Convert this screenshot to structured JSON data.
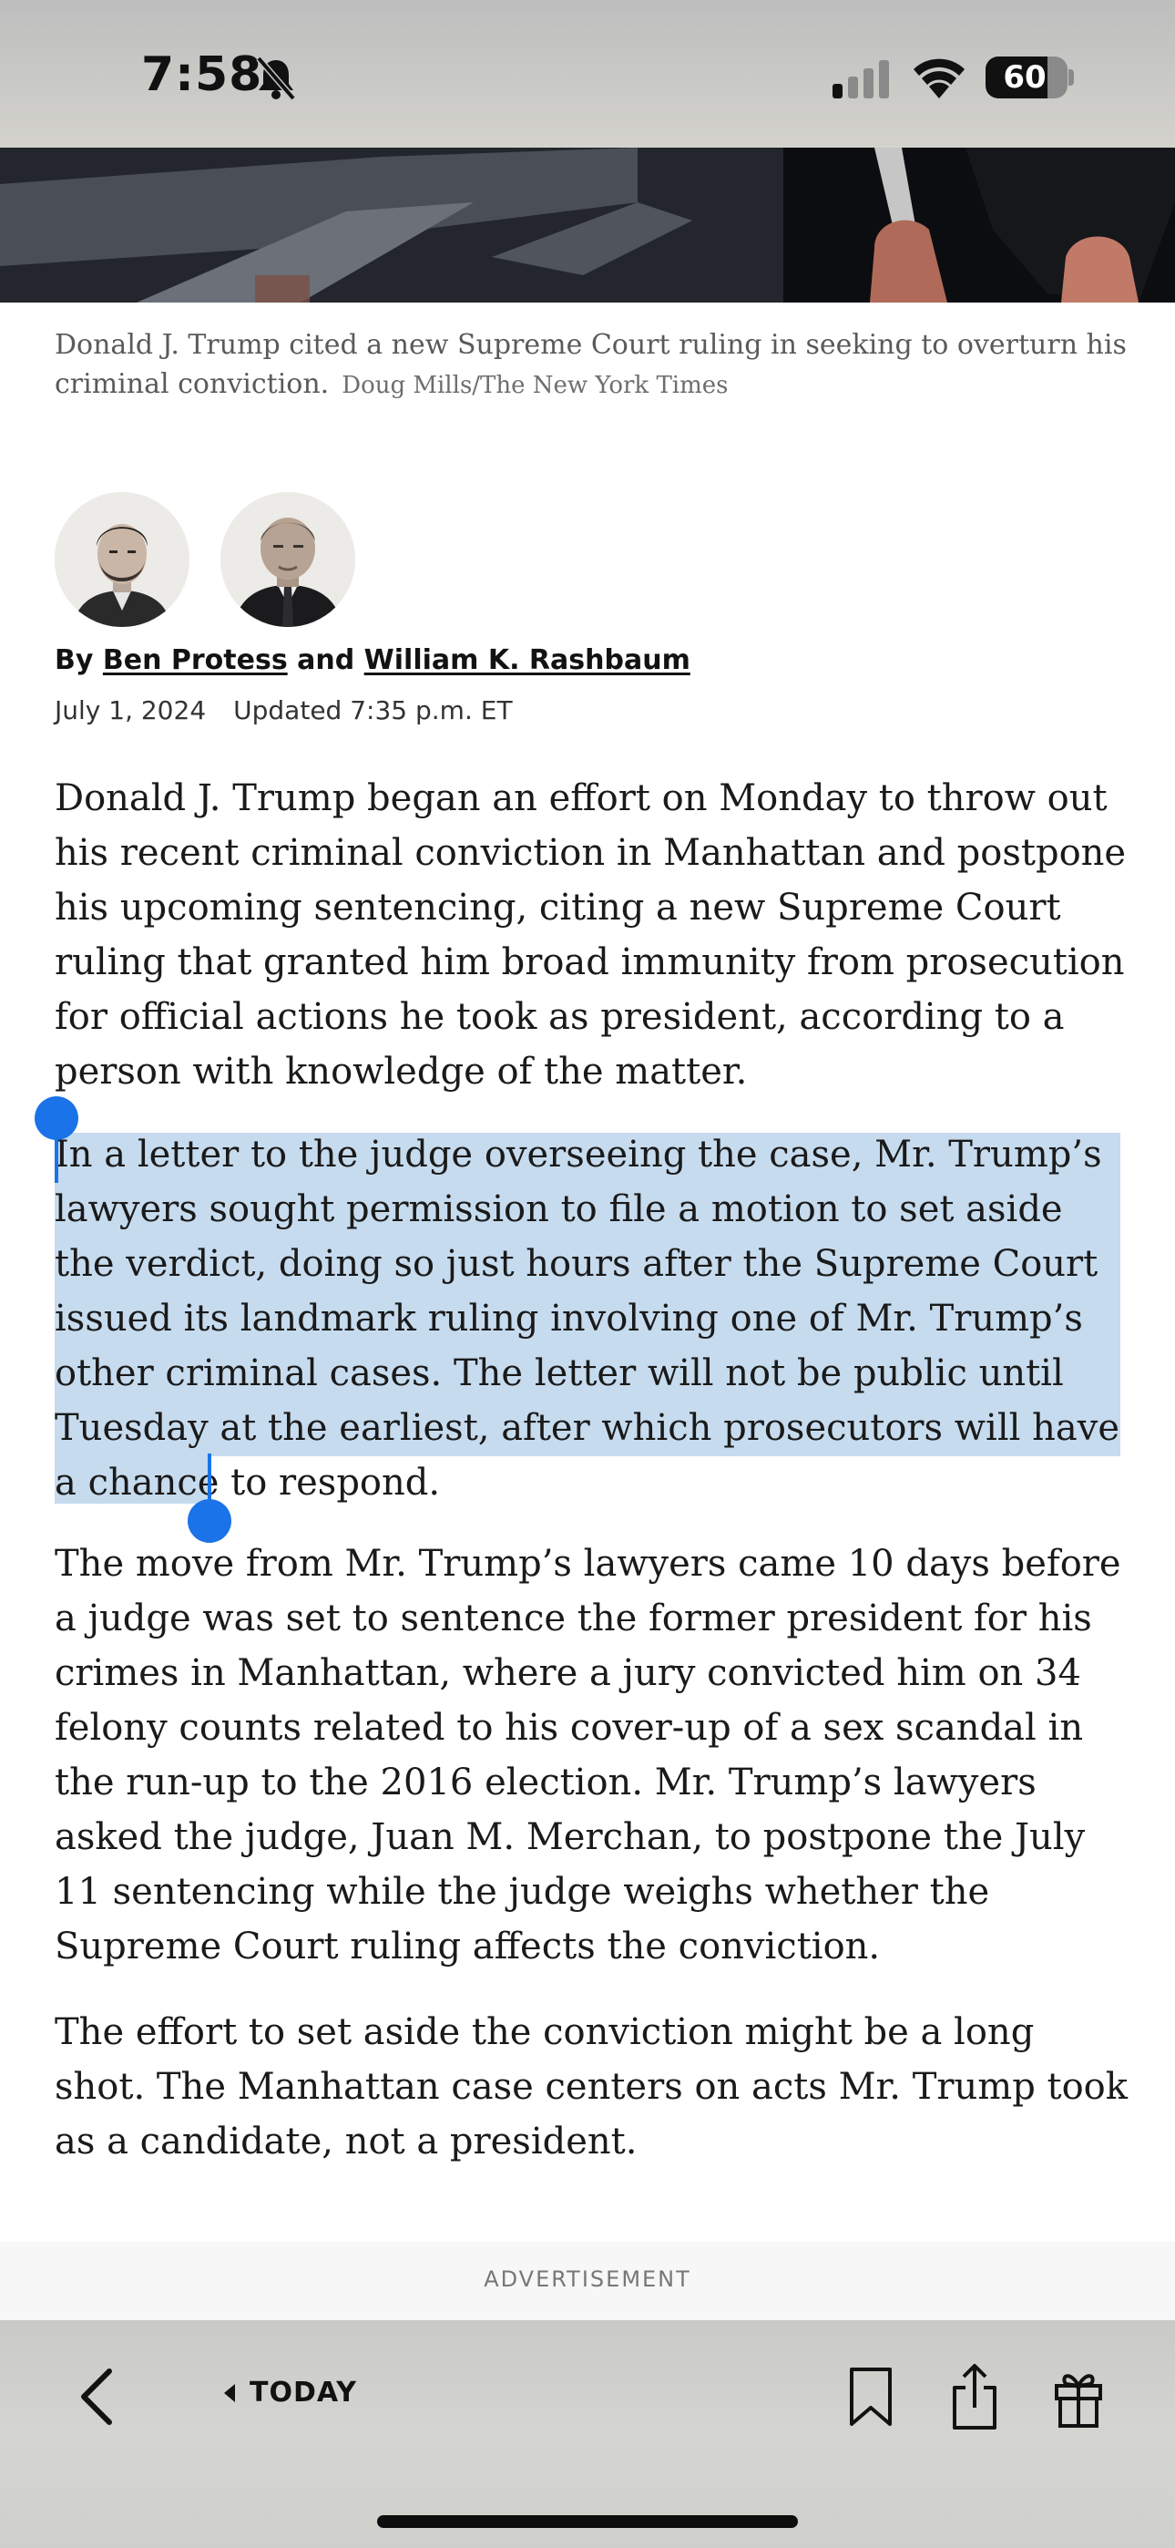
{
  "status_bar": {
    "time": "7:58",
    "battery": "60"
  },
  "caption": {
    "text": "Donald J. Trump cited a new Supreme Court ruling in seeking to overturn his criminal conviction.",
    "credit": "Doug Mills/The New York Times"
  },
  "byline": {
    "prefix": "By",
    "author1": "Ben Protess",
    "conj": "and",
    "author2": "William K. Rashbaum"
  },
  "dateline": {
    "date": "July 1, 2024",
    "updated": "Updated 7:35 p.m. ET"
  },
  "article": {
    "paragraphs": [
      "Donald J. Trump began an effort on Monday to throw out his recent criminal conviction in Manhattan and postpone his upcoming sentencing, citing a new Supreme Court ruling that granted him broad immunity from prosecution for official actions he took as president, according to a person with knowledge of the matter.",
      "In a letter to the judge overseeing the case, Mr. Trump’s lawyers sought permission to file a motion to set aside the verdict, doing so just hours after the Supreme Court issued its landmark ruling involving one of Mr. Trump’s other criminal cases. The letter will not be public until Tuesday at the earliest, after which prosecutors will have a chance to respond.",
      "The move from Mr. Trump’s lawyers came 10 days before a judge was set to sentence the former president for his crimes in Manhattan, where a jury convicted him on 34 felony counts related to his cover-up of a sex scandal in the run-up to the 2016 election. Mr. Trump’s lawyers asked the judge, Juan M. Merchan, to postpone the July 11 sentencing while the judge weighs whether the Supreme Court ruling affects the conviction.",
      "The effort to set aside the conviction might be a long shot. The Manhattan case centers on acts Mr. Trump took as a candidate, not a president."
    ]
  },
  "ad": {
    "label": "ADVERTISEMENT"
  },
  "toolbar": {
    "today_label": "TODAY"
  },
  "colors": {
    "selection": "#c6dbee",
    "selection_handle": "#1a73e8"
  }
}
